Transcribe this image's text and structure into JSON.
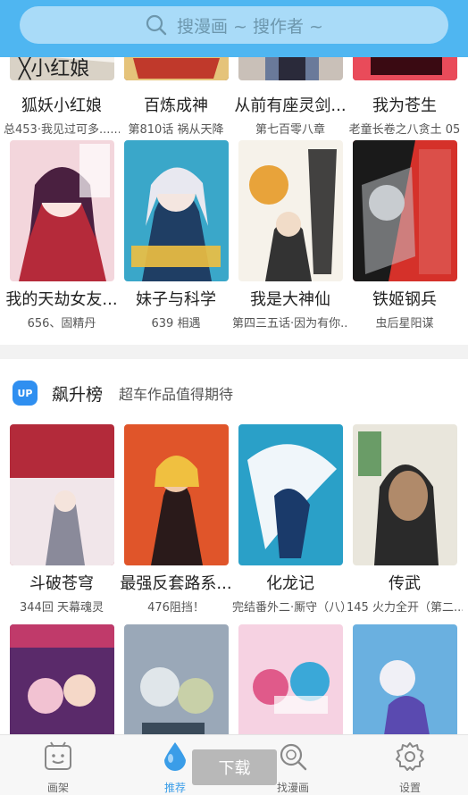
{
  "search": {
    "placeholder": "搜漫画 ~ 搜作者 ~"
  },
  "row_top": [
    {
      "title": "狐妖小红娘",
      "sub": "总453·我见过可多......",
      "colors": [
        "#f4f1ec",
        "#c33",
        "#222"
      ]
    },
    {
      "title": "百炼成神",
      "sub": "第810话 祸从天降",
      "colors": [
        "#e5c37a",
        "#c0392b",
        "#5a2a1a"
      ]
    },
    {
      "title": "从前有座灵剑...",
      "sub": "第七百零八章",
      "colors": [
        "#c9c0b8",
        "#6a7a9a",
        "#2a2a3a"
      ]
    },
    {
      "title": "我为苍生",
      "sub": "老童长卷之八贪土 05",
      "colors": [
        "#7a1c2a",
        "#e94b5a",
        "#222"
      ]
    }
  ],
  "row_second": [
    {
      "title": "我的天劫女友...",
      "sub": "656、固精丹",
      "colors": [
        "#f3d6dc",
        "#b52a3a",
        "#4a2040"
      ]
    },
    {
      "title": "妹子与科学",
      "sub": "639 相遇",
      "colors": [
        "#3aa7c9",
        "#e8e8f0",
        "#1f3e64"
      ]
    },
    {
      "title": "我是大神仙",
      "sub": "第四三五话·因为有你...",
      "colors": [
        "#f6f2ea",
        "#e8a33a",
        "#222"
      ]
    },
    {
      "title": "铁姬钢兵",
      "sub": "虫后星阳谋",
      "colors": [
        "#d5312a",
        "#1a1a1a",
        "#c8ccd0"
      ]
    }
  ],
  "section": {
    "badge": "UP",
    "title": "飙升榜",
    "subtitle": "超车作品值得期待"
  },
  "row_third": [
    {
      "title": "斗破苍穹",
      "sub": "344回 天幕魂灵",
      "colors": [
        "#b32a3a",
        "#f1e6ea",
        "#8a8a9a"
      ]
    },
    {
      "title": "最强反套路系...",
      "sub": "476阻挡！",
      "colors": [
        "#e0552a",
        "#2a1a1a",
        "#f0c040"
      ]
    },
    {
      "title": "化龙记",
      "sub": "完结番外二·厮守（八）",
      "colors": [
        "#2aa0c8",
        "#f0f6fa",
        "#1a3a6a"
      ]
    },
    {
      "title": "传武",
      "sub": "145 火力全开（第二...",
      "colors": [
        "#e9e6dc",
        "#2a2a2a",
        "#4a8a4a"
      ]
    }
  ],
  "row_fourth": [
    {
      "title": "",
      "sub": "",
      "colors": [
        "#5a2a6a",
        "#f2c2d2",
        "#c03a6a"
      ]
    },
    {
      "title": "",
      "sub": "",
      "colors": [
        "#9aa8b8",
        "#e0e6ea",
        "#3a4a5a"
      ]
    },
    {
      "title": "",
      "sub": "",
      "colors": [
        "#f6d2e2",
        "#3aa8d8",
        "#e05a8a"
      ]
    },
    {
      "title": "",
      "sub": "",
      "colors": [
        "#6ab0e0",
        "#f0f0f6",
        "#5a4ab0"
      ]
    }
  ],
  "nav": {
    "items": [
      {
        "label": "画架",
        "icon": "shelf-icon",
        "active": false
      },
      {
        "label": "推荐",
        "icon": "drop-icon",
        "active": true
      },
      {
        "label": "找漫画",
        "icon": "search-icon",
        "active": false
      },
      {
        "label": "设置",
        "icon": "gear-icon",
        "active": false
      }
    ],
    "download_label": "下载"
  },
  "colors": {
    "header": "#4fb6f1",
    "accent": "#3a9de8"
  }
}
